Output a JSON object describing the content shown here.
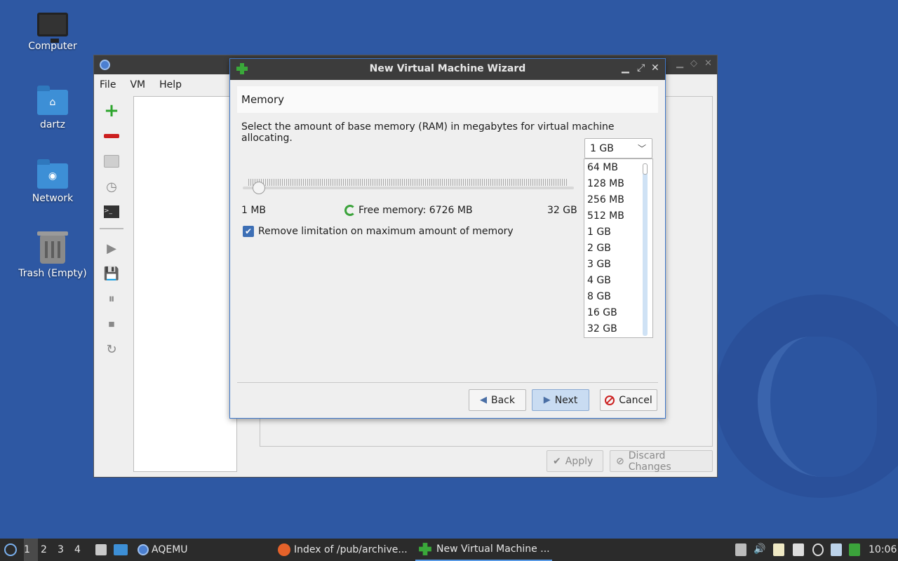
{
  "desktop": {
    "icons": [
      {
        "label": "Computer"
      },
      {
        "label": "dartz"
      },
      {
        "label": "Network"
      },
      {
        "label": "Trash (Empty)"
      }
    ]
  },
  "main_window": {
    "menu": [
      "File",
      "VM",
      "Help"
    ],
    "apply_label": "Apply",
    "discard_label": "Discard Changes"
  },
  "wizard": {
    "title": "New Virtual Machine Wizard",
    "page_title": "Memory",
    "description": "Select the amount of base memory (RAM) in megabytes for virtual machine allocating.",
    "memory_select": {
      "selected": "1 GB",
      "options": [
        "64 MB",
        "128 MB",
        "256 MB",
        "512 MB",
        "1 GB",
        "2 GB",
        "3 GB",
        "4 GB",
        "8 GB",
        "16 GB",
        "32 GB"
      ]
    },
    "slider": {
      "min_label": "1 MB",
      "max_label": "32 GB",
      "value_fraction": 0.03
    },
    "free_memory": "Free memory: 6726 MB",
    "remove_limitation_label": "Remove limitation on maximum amount of memory",
    "remove_limitation_checked": true,
    "buttons": {
      "back": "Back",
      "next": "Next",
      "cancel": "Cancel"
    }
  },
  "taskbar": {
    "workspaces": [
      "1",
      "2",
      "3",
      "4"
    ],
    "active_workspace": "1",
    "tasks": [
      {
        "label": "AQEMU",
        "icon": "aqemu-icon"
      },
      {
        "label": "Index of /pub/archive...",
        "icon": "firefox-icon"
      },
      {
        "label": "New Virtual Machine ...",
        "icon": "plus-icon"
      }
    ],
    "clock": "10:06"
  },
  "colors": {
    "desktop_bg": "#2e58a3",
    "accent": "#3d6fb5",
    "titlebar": "#3c3c3c"
  }
}
